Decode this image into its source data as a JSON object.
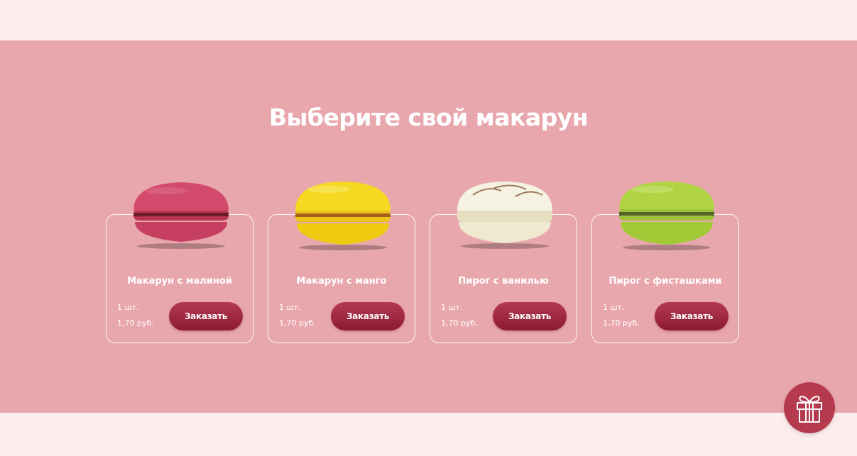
{
  "section": {
    "title": "Выберите свой макарун"
  },
  "products": [
    {
      "name": "Макарун с малиной",
      "qty": "1 шт.",
      "price": "1,70 руб.",
      "button": "Заказать",
      "color_shell": "#d24b6c",
      "color_filling": "#7a1f2c",
      "icon": "raspberry-macaron-image"
    },
    {
      "name": "Макарун с манго",
      "qty": "1 шт.",
      "price": "1,70 руб.",
      "button": "Заказать",
      "color_shell": "#f2d31c",
      "color_filling": "#b06a18",
      "icon": "mango-macaron-image"
    },
    {
      "name": "Пирог с ванилью",
      "qty": "1 шт.",
      "price": "1,70 руб.",
      "button": "Заказать",
      "color_shell": "#f3efdc",
      "color_filling": "#e7dcc0",
      "icon": "vanilla-macaron-image"
    },
    {
      "name": "Пирог с фисташками",
      "qty": "1 шт.",
      "price": "1,70 руб.",
      "button": "Заказать",
      "color_shell": "#a9cf3c",
      "color_filling": "#5d6b2a",
      "icon": "pistachio-macaron-image"
    }
  ],
  "gift": {
    "icon": "gift-icon"
  },
  "colors": {
    "page_bg": "#fdeeee",
    "section_bg": "#e8a7ad",
    "button": "#9b2540",
    "gift_button": "#b53a4d"
  }
}
